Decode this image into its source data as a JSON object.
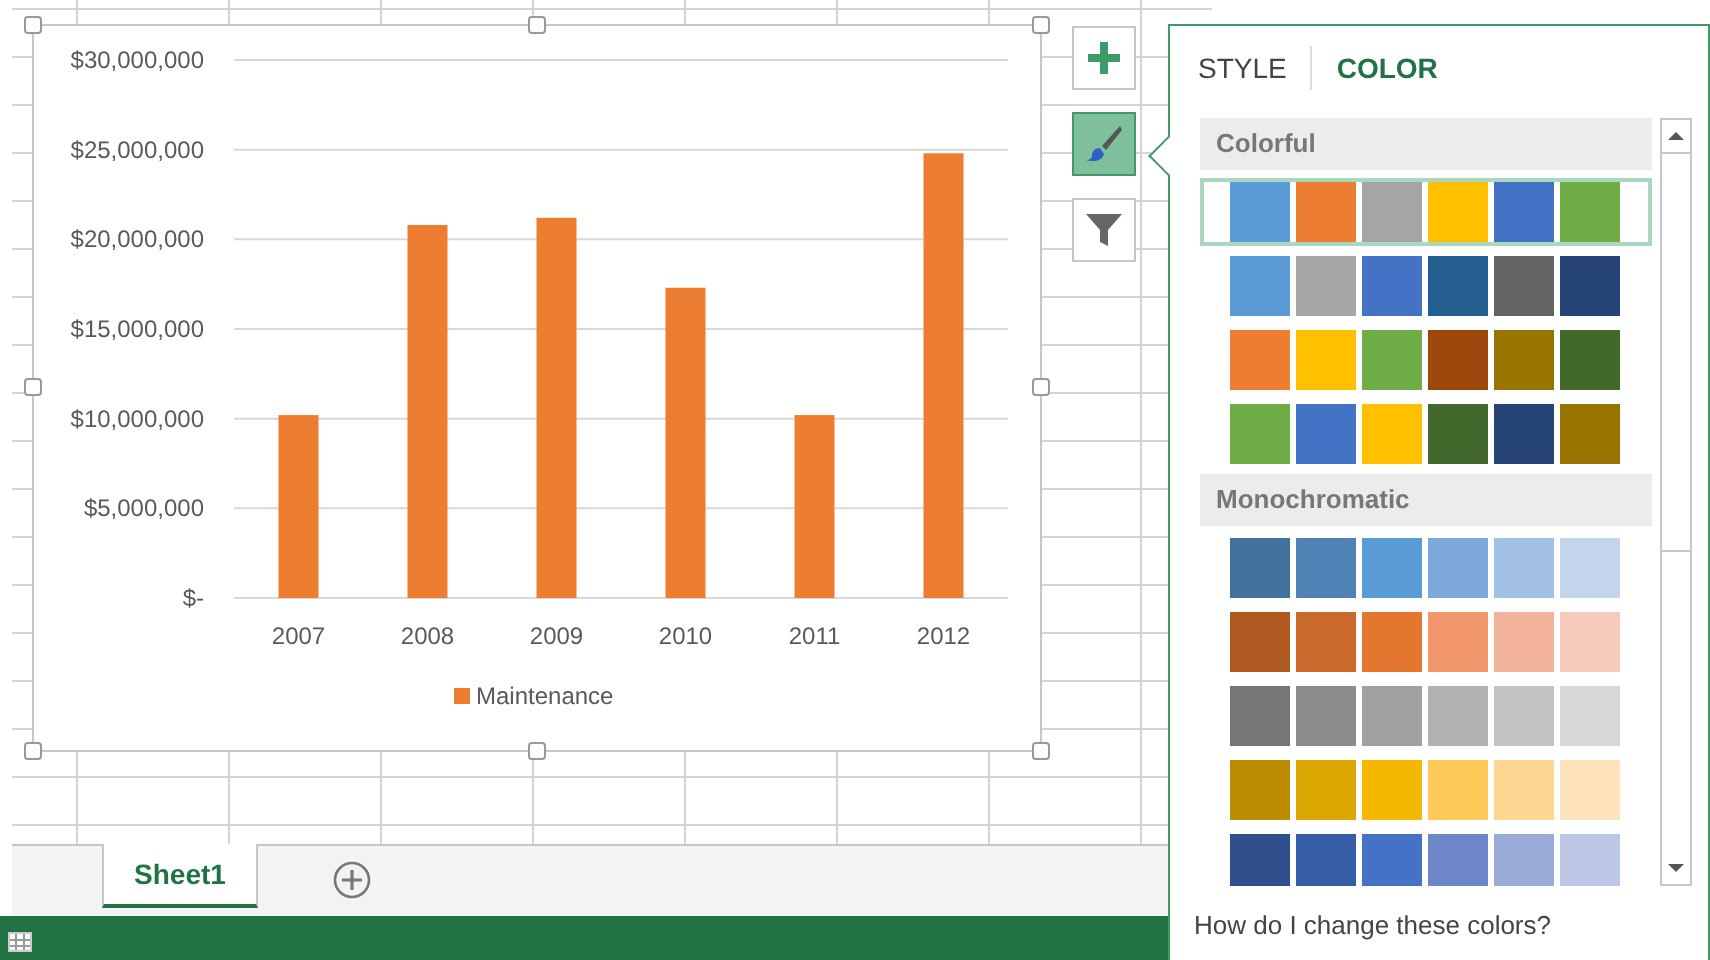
{
  "chart": {
    "chart_data": {
      "type": "bar",
      "categories": [
        "2007",
        "2008",
        "2009",
        "2010",
        "2011",
        "2012"
      ],
      "series": [
        {
          "name": "Maintenance",
          "color": "#ed7d31",
          "values": [
            10200000,
            20800000,
            21200000,
            17300000,
            10200000,
            24800000
          ]
        }
      ],
      "ylim": [
        0,
        30000000
      ],
      "grid": true,
      "yticks": [
        {
          "value": 0,
          "label": "$-"
        },
        {
          "value": 5000000,
          "label": "$5,000,000"
        },
        {
          "value": 10000000,
          "label": "$10,000,000"
        },
        {
          "value": 15000000,
          "label": "$15,000,000"
        },
        {
          "value": 20000000,
          "label": "$20,000,000"
        },
        {
          "value": 25000000,
          "label": "$25,000,000"
        },
        {
          "value": 30000000,
          "label": "$30,000,000"
        }
      ]
    }
  },
  "chart_buttons": [
    {
      "kind": "add",
      "selected": false
    },
    {
      "kind": "brush",
      "selected": true
    },
    {
      "kind": "filter",
      "selected": false
    }
  ],
  "panel": {
    "tabs": [
      {
        "label": "STYLE",
        "selected": false
      },
      {
        "label": "COLOR",
        "selected": true
      }
    ],
    "groups": [
      {
        "title": "Colorful",
        "rows": [
          {
            "selected": true,
            "swatches": [
              {
                "color": "#5b9bd5"
              },
              {
                "color": "#ed7d31"
              },
              {
                "color": "#a5a5a5"
              },
              {
                "color": "#ffc000"
              },
              {
                "color": "#4472c4"
              },
              {
                "color": "#70ad47"
              }
            ]
          },
          {
            "selected": false,
            "swatches": [
              {
                "color": "#5b9bd5"
              },
              {
                "color": "#a5a5a5"
              },
              {
                "color": "#4472c4"
              },
              {
                "color": "#255e91"
              },
              {
                "color": "#636363"
              },
              {
                "color": "#264478"
              }
            ]
          },
          {
            "selected": false,
            "swatches": [
              {
                "color": "#ed7d31"
              },
              {
                "color": "#ffc000"
              },
              {
                "color": "#70ad47"
              },
              {
                "color": "#9e480e"
              },
              {
                "color": "#997300"
              },
              {
                "color": "#43682b"
              }
            ]
          },
          {
            "selected": false,
            "swatches": [
              {
                "color": "#70ad47"
              },
              {
                "color": "#4472c4"
              },
              {
                "color": "#ffc000"
              },
              {
                "color": "#43682b"
              },
              {
                "color": "#264478"
              },
              {
                "color": "#997300"
              }
            ]
          }
        ]
      },
      {
        "title": "Monochromatic",
        "rows": [
          {
            "selected": false,
            "swatches": [
              {
                "color": "#41719c"
              },
              {
                "color": "#4e82b4"
              },
              {
                "color": "#5b9bd5"
              },
              {
                "color": "#7ca8dc"
              },
              {
                "color": "#a3c1e5"
              },
              {
                "color": "#c3d5ed"
              }
            ]
          },
          {
            "selected": false,
            "swatches": [
              {
                "color": "#ae5a21"
              },
              {
                "color": "#c9692b"
              },
              {
                "color": "#e3772f"
              },
              {
                "color": "#f1956a"
              },
              {
                "color": "#f3b29b"
              },
              {
                "color": "#f6cbbd"
              }
            ]
          },
          {
            "selected": false,
            "swatches": [
              {
                "color": "#767676"
              },
              {
                "color": "#8b8b8b"
              },
              {
                "color": "#a0a0a0"
              },
              {
                "color": "#b1b1b1"
              },
              {
                "color": "#c3c3c3"
              },
              {
                "color": "#d7d7d7"
              }
            ]
          },
          {
            "selected": false,
            "swatches": [
              {
                "color": "#bc8c00"
              },
              {
                "color": "#daa600"
              },
              {
                "color": "#f4b800"
              },
              {
                "color": "#ffc95a"
              },
              {
                "color": "#ffd592"
              },
              {
                "color": "#ffe3bd"
              }
            ]
          },
          {
            "selected": false,
            "swatches": [
              {
                "color": "#2e4f8c"
              },
              {
                "color": "#375da6"
              },
              {
                "color": "#4472c4"
              },
              {
                "color": "#6d87c9"
              },
              {
                "color": "#9aabd8"
              },
              {
                "color": "#bcc7e5"
              }
            ]
          }
        ]
      }
    ],
    "help_link": "How do I change these colors?"
  },
  "sheet_tabs": [
    {
      "label": "Sheet1",
      "selected": true
    }
  ]
}
